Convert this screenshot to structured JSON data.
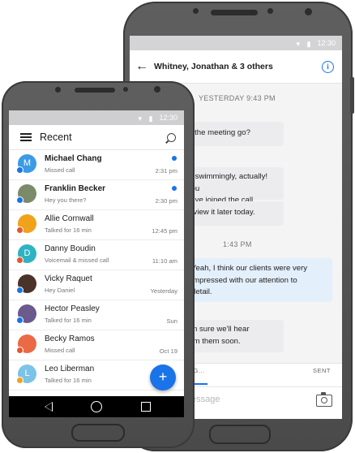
{
  "status": {
    "back_time": "12:30",
    "front_time": "12:30"
  },
  "chat": {
    "title": "Whitney, Jonathan & 3 others",
    "day_separator": "YESTERDAY 9:43 PM",
    "time_separator": "1:43 PM",
    "messages": [
      {
        "text": "id the meeting go?",
        "mine": false
      },
      {
        "text": "nt swimmingly, actually! You\nhave joined the call.",
        "mine": false
      },
      {
        "text": "review it later today.",
        "mine": false
      },
      {
        "text": "Yeah, I think our clients were very\nimpressed with our attention to\ndetail.",
        "mine": true
      },
      {
        "text": "am sure we'll hear\nrom them soon.",
        "mine": false
      }
    ],
    "tab_left": "ING...",
    "tab_right": "SENT",
    "message_placeholder": "essage"
  },
  "recent": {
    "title": "Recent",
    "fab_label": "+",
    "items": [
      {
        "initial": "M",
        "name": "Michael Chang",
        "sub": "Missed call",
        "time": "2:31 pm",
        "unread": true,
        "bold": true,
        "avatar_color": "#3b9be5",
        "badge_color": "#1a73e8"
      },
      {
        "initial": "",
        "name": "Franklin Becker",
        "sub": "Hey you there?",
        "time": "2:30 pm",
        "unread": true,
        "bold": true,
        "avatar_color": "#7b8a6a",
        "badge_color": "#1a73e8"
      },
      {
        "initial": "",
        "name": "Allie Cornwall",
        "sub": "Talked for 16 min",
        "time": "12:45 pm",
        "unread": false,
        "bold": false,
        "avatar_color": "#f0a21a",
        "badge_color": "#e4572e"
      },
      {
        "initial": "D",
        "name": "Danny Boudin",
        "sub": "Voicemail & missed call",
        "time": "11:10 am",
        "unread": false,
        "bold": false,
        "avatar_color": "#2fb3c3",
        "badge_color": "#e4572e"
      },
      {
        "initial": "",
        "name": "Vicky Raquet",
        "sub": "Hey Daniel",
        "time": "Yesterday",
        "unread": false,
        "bold": false,
        "avatar_color": "#4a3328",
        "badge_color": "#1a73e8"
      },
      {
        "initial": "",
        "name": "Hector Peasley",
        "sub": "Talked for 16 min",
        "time": "Sun",
        "unread": false,
        "bold": false,
        "avatar_color": "#6b5a8c",
        "badge_color": "#1a73e8"
      },
      {
        "initial": "",
        "name": "Becky Ramos",
        "sub": "Missed call",
        "time": "Oct 19",
        "unread": false,
        "bold": false,
        "avatar_color": "#ea6a46",
        "badge_color": "#e4572e"
      },
      {
        "initial": "L",
        "name": "Leo Liberman",
        "sub": "Talked for 16 min",
        "time": "",
        "unread": false,
        "bold": false,
        "avatar_color": "#7cc3e8",
        "badge_color": "#f0a21a"
      }
    ]
  }
}
